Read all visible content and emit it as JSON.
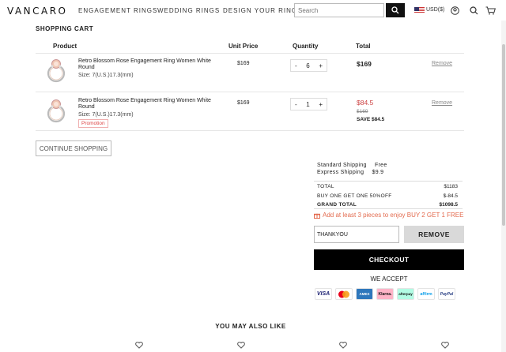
{
  "header": {
    "logo": "VANCARO",
    "nav": [
      "ENGAGEMENT RINGS",
      "WEDDING RINGS",
      "DESIGN YOUR RING"
    ],
    "search_placeholder": "Search",
    "currency": "USD($)"
  },
  "cart": {
    "title": "SHOPPING CART",
    "columns": {
      "product": "Product",
      "unit_price": "Unit Price",
      "quantity": "Quantity",
      "total": "Total"
    },
    "items": [
      {
        "name": "Retro Blossom Rose Engagement Ring Women White Round",
        "size": "Size: 7(U.S.)17.3(mm)",
        "unit_price": "$169",
        "quantity": "6",
        "total": "$169",
        "remove": "Remove"
      },
      {
        "name": "Retro Blossom Rose Engagement Ring Women White Round",
        "size": "Size: 7(U.S.)17.3(mm)",
        "promotion": "Promotion",
        "unit_price": "$169",
        "quantity": "1",
        "total": "$84.5",
        "old_price": "$169",
        "save": "SAVE $84.5",
        "remove": "Remove"
      }
    ],
    "qty_minus": "-",
    "qty_plus": "+",
    "continue_label": "CONTINUE SHOPPING"
  },
  "summary": {
    "standard_shipping_label": "Standard Shipping",
    "standard_shipping_value": "Free",
    "express_shipping_label": "Express Shipping",
    "express_shipping_value": "$9.9",
    "total_label": "TOTAL",
    "total_value": "$1183",
    "bogo_label": "BUY ONE GET ONE 50%OFF",
    "bogo_value": "$-84.5",
    "grand_total_label": "GRAND TOTAL",
    "grand_total_value": "$1098.5",
    "promo_message": "Add at least 3 pieces to enjoy BUY 2 GET 1 FREE",
    "coupon_value": "THANKYOU",
    "remove_label": "REMOVE",
    "checkout_label": "CHECKOUT",
    "we_accept": "WE ACCEPT",
    "payments": [
      "VISA",
      "",
      "AMEX",
      "Klarna.",
      "afterpay",
      "affirm",
      "PayPal"
    ]
  },
  "recommend": {
    "title": "YOU MAY ALSO LIKE"
  },
  "colors": {
    "accent": "#000000",
    "sale_red": "#c44444",
    "promo_orange": "#e36b4f"
  }
}
